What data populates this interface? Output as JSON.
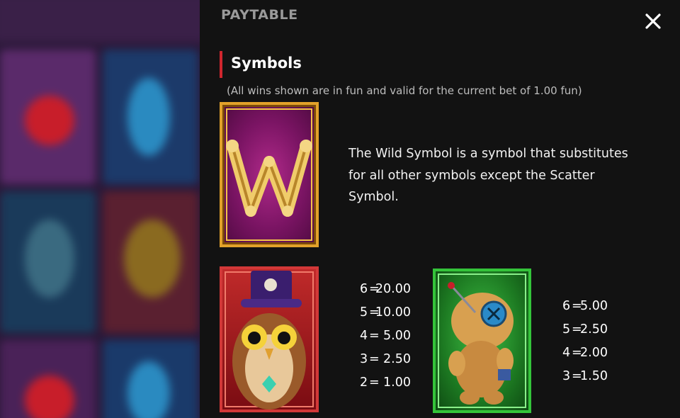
{
  "panel": {
    "title": "PAYTABLE",
    "close_icon": "close-icon"
  },
  "section": {
    "title": "Symbols",
    "note": "(All wins shown are in fun and valid for the current bet of 1.00 fun)"
  },
  "wild": {
    "icon": "wild-w-symbol",
    "letter": "W",
    "description": "The Wild Symbol is a symbol that substitutes for all other symbols except the Scatter Symbol."
  },
  "owl": {
    "icon": "owl-top-hat-symbol",
    "pays": [
      {
        "count": "6",
        "value": "20.00"
      },
      {
        "count": "5",
        "value": "10.00"
      },
      {
        "count": "4",
        "value": "5.00"
      },
      {
        "count": "3",
        "value": "2.50"
      },
      {
        "count": "2",
        "value": "1.00"
      }
    ]
  },
  "voodoo_doll": {
    "icon": "voodoo-doll-symbol",
    "pays": [
      {
        "count": "6",
        "value": "5.00"
      },
      {
        "count": "5",
        "value": "2.50"
      },
      {
        "count": "4",
        "value": "2.00"
      },
      {
        "count": "3",
        "value": "1.50"
      }
    ]
  },
  "colors": {
    "accent": "#d0262e",
    "panel": "#121212",
    "title": "#9a9a9a"
  }
}
